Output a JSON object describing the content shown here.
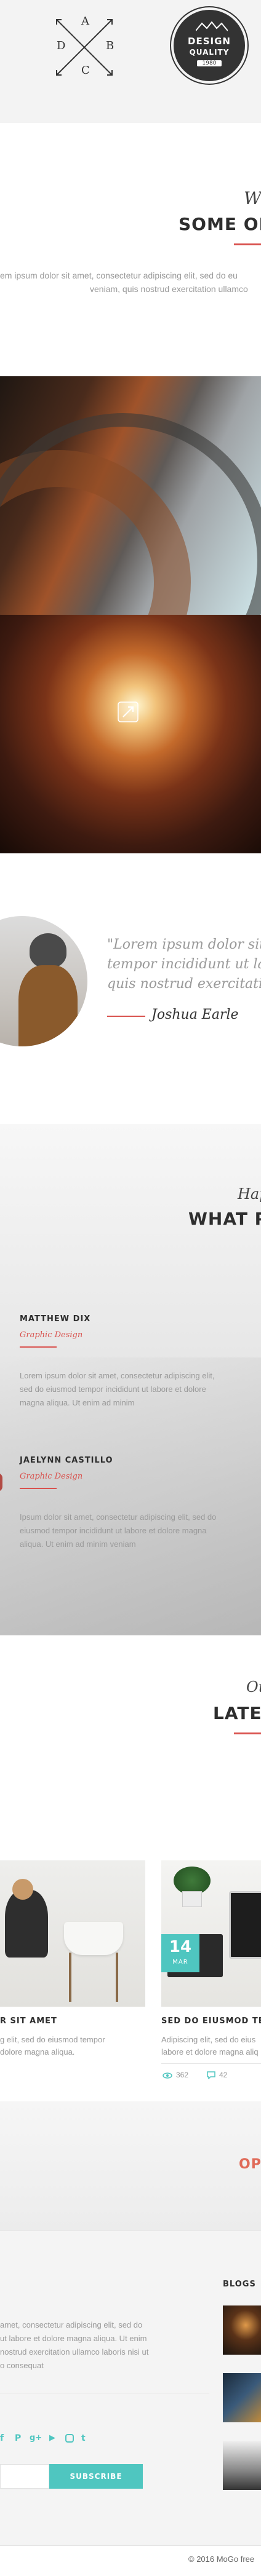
{
  "logos": {
    "compass_letters": [
      "A",
      "B",
      "C",
      "D"
    ],
    "badge_top": "DESIGN",
    "badge_mid": "QUALITY",
    "badge_year": "1980"
  },
  "about": {
    "script_heading": "W",
    "heading": "SOME OF",
    "text_line1": "em ipsum dolor sit amet, consectetur adipiscing elit, sed do eu",
    "text_line2": "veniam, quis nostrud exercitation ullamco"
  },
  "testimonial": {
    "quote_line1": "\"Lorem ipsum dolor sit am",
    "quote_line2": "tempor incididunt ut labor",
    "quote_line3": "quis nostrud exercitation.",
    "author": "Joshua Earle"
  },
  "team": {
    "script_heading": "Hap",
    "heading": "WHAT P",
    "members": [
      {
        "name": "MATTHEW DIX",
        "role": "Graphic Design",
        "text_line1": "Lorem ipsum dolor sit amet, consectetur adipiscing elit,",
        "text_line2": "sed do eiusmod tempor incididunt ut labore et dolore",
        "text_line3": "magna aliqua. Ut enim ad minim"
      },
      {
        "name": "JAELYNN CASTILLO",
        "role": "Graphic Design",
        "text_line1": "Ipsum dolor sit amet, consectetur adipiscing elit, sed do",
        "text_line2": "eiusmod tempor incididunt ut labore et dolore magna",
        "text_line3": "aliqua. Ut enim ad minim veniam"
      }
    ]
  },
  "blog": {
    "script_heading": "Ou",
    "heading": "LATE",
    "posts": [
      {
        "title": "R SIT AMET",
        "text_line1": "g elit, sed do eiusmod tempor",
        "text_line2": "dolore magna aliqua."
      },
      {
        "date_day": "14",
        "date_month": "MAR",
        "title": "SED DO EIUSMOD TEM",
        "text_line1": "Adipiscing elit, sed do eius",
        "text_line2": "labore et dolore magna aliq",
        "views": "362",
        "likes": "42"
      }
    ]
  },
  "cta": {
    "text": "OP"
  },
  "footer": {
    "text_line1": "amet, consectetur adipiscing elit, sed do",
    "text_line2": "ut labore et dolore magna aliqua. Ut enim",
    "text_line3": "nostrud exercitation ullamco laboris nisi ut",
    "text_line4": "o consequat",
    "blogs_heading": "BLOGS",
    "social_icons": [
      "facebook-icon",
      "pinterest-icon",
      "google-plus-icon",
      "youtube-icon",
      "instagram-icon",
      "tumblr-icon"
    ],
    "subscribe_label": "SUBSCRIBE",
    "copyright": "© 2016 MoGo free"
  },
  "colors": {
    "accent": "#4fc6c0",
    "red_line": "#d9534f"
  }
}
